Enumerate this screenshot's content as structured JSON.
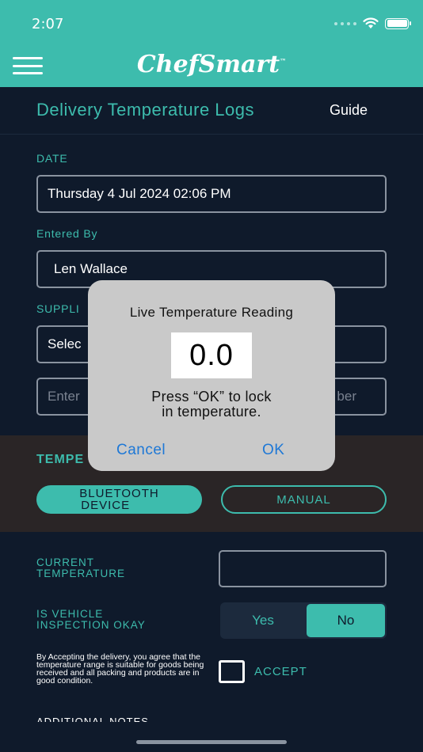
{
  "status_bar": {
    "time": "2:07"
  },
  "header": {
    "logo": "ChefSmart",
    "logo_tm": "™"
  },
  "page": {
    "title": "Delivery Temperature Logs",
    "guide_label": "Guide"
  },
  "form": {
    "date_label": "DATE",
    "date_value": "Thursday 4 Jul 2024 02:06 PM",
    "entered_by_label": "Entered By",
    "entered_by_value": "Len Wallace",
    "supplier_label": "SUPPLI",
    "supplier_value": "Selec",
    "invoice_left": "Enter",
    "invoice_right": "ber"
  },
  "temperature": {
    "section_label": "TEMPE",
    "bluetooth_line1": "BLUETOOTH",
    "bluetooth_line2": "DEVICE",
    "manual_label": "MANUAL",
    "current_label_line1": "CURRENT",
    "current_label_line2": "TEMPERATURE",
    "current_value": ""
  },
  "vehicle": {
    "label_line1": "IS VEHICLE",
    "label_line2": "INSPECTION OKAY",
    "yes_label": "Yes",
    "no_label": "No",
    "selected": "No"
  },
  "accept": {
    "disclaimer": "By Accepting the delivery, you agree that the temperature range is suitable for goods being received and all packing and products are in good condition.",
    "label": "ACCEPT",
    "checked": false
  },
  "additional_notes_label": "ADDITIONAL NOTES",
  "modal": {
    "title": "Live Temperature Reading",
    "reading": "0.0",
    "message_line1": "Press “OK” to lock",
    "message_line2": "in temperature.",
    "cancel_label": "Cancel",
    "ok_label": "OK"
  },
  "colors": {
    "accent": "#3dbcad",
    "background": "#0f1a2b",
    "link": "#1e78d6"
  }
}
